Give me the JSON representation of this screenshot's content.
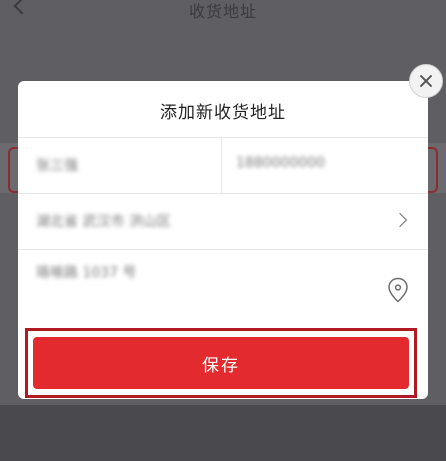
{
  "background": {
    "title": "收货地址"
  },
  "modal": {
    "title": "添加新收货地址",
    "name_value": "张三强",
    "phone_value": "1880000000",
    "region_value": "湖北省 武汉市 洪山区",
    "detail_value": "珞喻路 1037 号",
    "save_label": "保存"
  },
  "colors": {
    "accent": "#e32a2f",
    "overlay": "#5f5e63"
  },
  "icons": {
    "close": "close-icon",
    "chevron": "chevron-right-icon",
    "location": "location-pin-icon"
  }
}
